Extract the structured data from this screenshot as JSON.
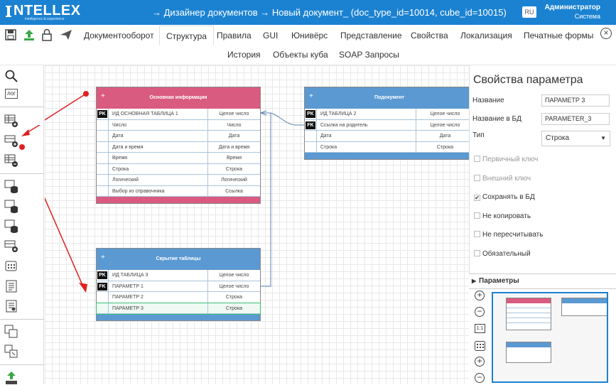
{
  "brand": {
    "logo_big": "NTELLEX",
    "logo_small": "intelligence & experience"
  },
  "header": {
    "breadcrumb": "→ Дизайнер документов  → Новый документ_ (doc_type_id=10014, cube_id=10015)",
    "lang": "RU",
    "user_name": "Администратор",
    "user_role": "Система"
  },
  "tabs": {
    "row1": [
      "Документооборот",
      "Структура",
      "Правила",
      "GUI",
      "Юнивёрс",
      "Представление",
      "Свойства",
      "Локализация",
      "Печатные формы"
    ],
    "row2": [
      "История",
      "Объекты куба",
      "SOAP Запросы"
    ],
    "active": "Структура"
  },
  "left_tools": {
    "log_label": "лог"
  },
  "tables": {
    "main": {
      "title": "Основная информация",
      "color": "#d95b80",
      "rows": [
        {
          "key": "PK",
          "name": "ИД ОСНОВНАЯ ТАБЛИЦА 1",
          "type": "Целое число"
        },
        {
          "key": "",
          "name": "Число",
          "type": "Число"
        },
        {
          "key": "",
          "name": "Дата",
          "type": "Дата"
        },
        {
          "key": "",
          "name": "Дата и время",
          "type": "Дата и время"
        },
        {
          "key": "",
          "name": "Время",
          "type": "Время"
        },
        {
          "key": "",
          "name": "Строка",
          "type": "Строка"
        },
        {
          "key": "",
          "name": "Логический",
          "type": "Логический"
        },
        {
          "key": "",
          "name": "Выбор из справочника",
          "type": "Ссылка"
        }
      ]
    },
    "sub": {
      "title": "Подокумент",
      "color": "#5b99d2",
      "rows": [
        {
          "key": "PK",
          "name": "ИД ТАБЛИЦА 2",
          "type": "Целое число"
        },
        {
          "key": "FK",
          "name": "Ссылка на родитель",
          "type": "Целое число"
        },
        {
          "key": "",
          "name": "Дата",
          "type": "Дата"
        },
        {
          "key": "",
          "name": "Строка",
          "type": "Строка"
        }
      ]
    },
    "hidden": {
      "title": "Скрытие таблицы",
      "color": "#5b99d2",
      "rows": [
        {
          "key": "PK",
          "name": "ИД ТАБЛИЦА 3",
          "type": "Целое число"
        },
        {
          "key": "FK",
          "name": "ПАРАМЕТР 1",
          "type": "Целое число"
        },
        {
          "key": "",
          "name": "ПАРАМЕТР 2",
          "type": "Строка"
        },
        {
          "key": "",
          "name": "ПАРАМЕТР 3",
          "type": "Строка"
        }
      ]
    }
  },
  "props": {
    "title": "Свойства параметра",
    "name_label": "Название",
    "name_value": "ПАРАМЕТР 3",
    "dbname_label": "Название в БД",
    "dbname_value": "PARAMETER_3",
    "type_label": "Тип",
    "type_value": "Строка",
    "checks": [
      {
        "label": "Первичный ключ",
        "checked": false,
        "disabled": true
      },
      {
        "label": "Внешний ключ",
        "checked": false,
        "disabled": true
      },
      {
        "label": "Сохранять в БД",
        "checked": true,
        "disabled": false
      },
      {
        "label": "Не копировать",
        "checked": false,
        "disabled": false
      },
      {
        "label": "Не пересчитывать",
        "checked": false,
        "disabled": false
      },
      {
        "label": "Обязательный",
        "checked": false,
        "disabled": false
      }
    ]
  },
  "params_bar": {
    "label": "Параметры"
  },
  "nav": {
    "zoom_label": "1:1"
  }
}
